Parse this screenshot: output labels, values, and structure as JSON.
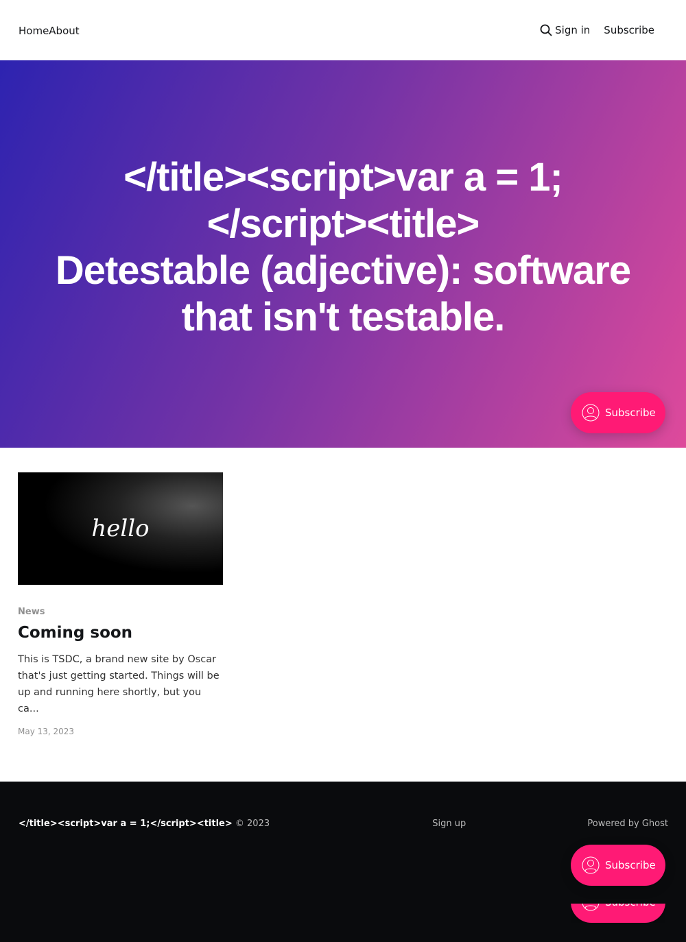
{
  "nav": {
    "home": "Home",
    "about": "About",
    "signin": "Sign in",
    "subscribe": "Subscribe"
  },
  "hero": {
    "title_line1": "</title><script>var a = 1;",
    "title_line2": "</script><title>",
    "title_line3": "Detestable (adjective): software that isn't testable."
  },
  "portal": {
    "label": "Subscribe"
  },
  "post": {
    "image_text": "hello",
    "tag": "News",
    "title": "Coming soon",
    "excerpt": "This is TSDC, a brand new site by Oscar that's just getting started. Things will be up and running here shortly, but you ca...",
    "date": "May 13, 2023"
  },
  "footer": {
    "site": "</title><script>var a = 1;</script><title>",
    "copyright": "© 2023",
    "signup": "Sign up",
    "powered": "Powered by Ghost"
  },
  "colors": {
    "accent": "#ff1a75",
    "footer_bg": "#0a0b0d"
  }
}
